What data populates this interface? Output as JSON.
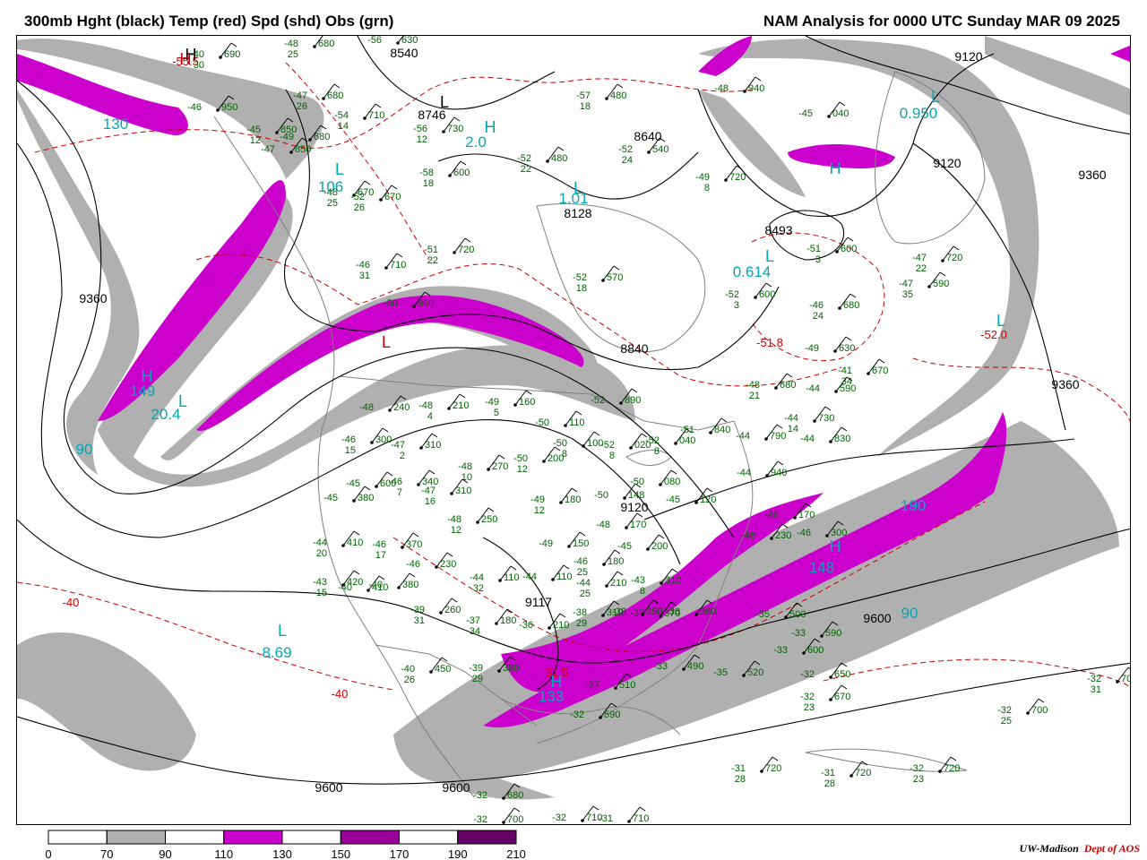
{
  "header": {
    "title_left": "300mb Hght (black) Temp (red) Spd (shd) Obs (grn)",
    "title_right": "NAM Analysis for 0000 UTC Sunday  MAR 09 2025"
  },
  "credit": {
    "org": "UW-Madison",
    "dept": "Dept of AOS"
  },
  "colors": {
    "height_contour": "#000000",
    "temp_contour": "#cc0000",
    "obs": "#006400",
    "speed_label": "#00a8b8",
    "border": "#808080",
    "speed_70_90": "#b0b0b0",
    "speed_110_130": "#cc00cc",
    "speed_150_170": "#990099",
    "speed_190_210": "#660066"
  },
  "legend": {
    "ticks": [
      "0",
      "70",
      "90",
      "110",
      "130",
      "150",
      "170",
      "190",
      "210"
    ],
    "bins": [
      {
        "from": "70",
        "to": "90",
        "color": "#b0b0b0"
      },
      {
        "from": "110",
        "to": "130",
        "color": "#cc00cc"
      },
      {
        "from": "150",
        "to": "170",
        "color": "#990099"
      },
      {
        "from": "190",
        "to": "210",
        "color": "#660066"
      }
    ]
  },
  "height_labels": [
    {
      "text": "8540"
    },
    {
      "text": "8746"
    },
    {
      "text": "8640"
    },
    {
      "text": "9120"
    },
    {
      "text": "9120"
    },
    {
      "text": "9360"
    },
    {
      "text": "9360"
    },
    {
      "text": "9360"
    },
    {
      "text": "8493"
    },
    {
      "text": "8840"
    },
    {
      "text": "8128"
    },
    {
      "text": "9120"
    },
    {
      "text": "9600"
    },
    {
      "text": "9600"
    },
    {
      "text": "9117"
    },
    {
      "text": "9600"
    }
  ],
  "temp_labels": [
    {
      "text": "-55.5"
    },
    {
      "text": "-51.8"
    },
    {
      "text": "-52.0"
    },
    {
      "text": "-40"
    },
    {
      "text": "-40"
    },
    {
      "text": "-31.5"
    }
  ],
  "pressure_centers": [
    {
      "letter": "H",
      "color": "#000000"
    },
    {
      "letter": "H",
      "color": "#cc0000"
    },
    {
      "letter": "L",
      "color": "#000000"
    },
    {
      "letter": "L",
      "color": "#cc0000"
    },
    {
      "letter": "H",
      "color": "#00a8b8"
    },
    {
      "letter": "L",
      "color": "#00a8b8"
    },
    {
      "letter": "L",
      "color": "#00a8b8"
    },
    {
      "letter": "L",
      "color": "#00a8b8"
    },
    {
      "letter": "L",
      "color": "#00a8b8"
    },
    {
      "letter": "L",
      "color": "#00a8b8"
    },
    {
      "letter": "H",
      "color": "#00a8b8"
    },
    {
      "letter": "L",
      "color": "#00a8b8"
    },
    {
      "letter": "H",
      "color": "#00a8b8"
    },
    {
      "letter": "L",
      "color": "#00a8b8"
    },
    {
      "letter": "H",
      "color": "#00a8b8"
    },
    {
      "letter": "H",
      "color": "#00a8b8"
    }
  ],
  "speed_labels": [
    {
      "text": "130"
    },
    {
      "text": "106"
    },
    {
      "text": "2.0"
    },
    {
      "text": "1.01"
    },
    {
      "text": "0.950"
    },
    {
      "text": "0.614"
    },
    {
      "text": "149"
    },
    {
      "text": "20.4"
    },
    {
      "text": "90"
    },
    {
      "text": "90"
    },
    {
      "text": "130"
    },
    {
      "text": "148"
    },
    {
      "text": "8.69"
    },
    {
      "text": "90"
    },
    {
      "text": "133"
    }
  ],
  "stations": [
    {
      "t": "-48",
      "d": "25",
      "v": "680"
    },
    {
      "t": "-40",
      "d": "30",
      "v": "690"
    },
    {
      "t": "-56",
      "d": "",
      "v": "630"
    },
    {
      "t": "-47",
      "d": "26",
      "v": "680"
    },
    {
      "t": "-54",
      "d": "14",
      "v": "710"
    },
    {
      "t": "-45",
      "d": "12",
      "v": "850"
    },
    {
      "t": "-49",
      "d": "",
      "v": "680"
    },
    {
      "t": "-47",
      "d": "",
      "v": "850"
    },
    {
      "t": "-46",
      "d": "",
      "v": "950"
    },
    {
      "t": "-56",
      "d": "12",
      "v": "730"
    },
    {
      "t": "-57",
      "d": "18",
      "v": "480"
    },
    {
      "t": "-52",
      "d": "22",
      "v": "480"
    },
    {
      "t": "-52",
      "d": "24",
      "v": "540"
    },
    {
      "t": "-48",
      "d": "",
      "v": "940"
    },
    {
      "t": "-45",
      "d": "",
      "v": "040"
    },
    {
      "t": "-48",
      "d": "25",
      "v": "670"
    },
    {
      "t": "-52",
      "d": "26",
      "v": "670"
    },
    {
      "t": "-58",
      "d": "18",
      "v": "600"
    },
    {
      "t": "-49",
      "d": "8",
      "v": "720"
    },
    {
      "t": "-51",
      "d": "22",
      "v": "720"
    },
    {
      "t": "-46",
      "d": "31",
      "v": "710"
    },
    {
      "t": "-52",
      "d": "18",
      "v": "570"
    },
    {
      "t": "-51",
      "d": "3",
      "v": "600"
    },
    {
      "t": "-47",
      "d": "22",
      "v": "720"
    },
    {
      "t": "-47",
      "d": "35",
      "v": "590"
    },
    {
      "t": "-52",
      "d": "3",
      "v": "600"
    },
    {
      "t": "-46",
      "d": "24",
      "v": "680"
    },
    {
      "t": "-50",
      "d": "",
      "v": "900"
    },
    {
      "t": "-49",
      "d": "",
      "v": "630"
    },
    {
      "t": "-41",
      "d": "34",
      "v": "670"
    },
    {
      "t": "-48",
      "d": "21",
      "v": "680"
    },
    {
      "t": "-44",
      "d": "",
      "v": "590"
    },
    {
      "t": "-48",
      "d": "",
      "v": "240"
    },
    {
      "t": "-48",
      "d": "4",
      "v": "210"
    },
    {
      "t": "-49",
      "d": "5",
      "v": "160"
    },
    {
      "t": "-52",
      "d": "",
      "v": "890"
    },
    {
      "t": "-46",
      "d": "15",
      "v": "300"
    },
    {
      "t": "-47",
      "d": "2",
      "v": "310"
    },
    {
      "t": "-50",
      "d": "",
      "v": "110"
    },
    {
      "t": "-50",
      "d": "8",
      "v": "100"
    },
    {
      "t": "-52",
      "d": "8",
      "v": "020"
    },
    {
      "t": "-52",
      "d": "8",
      "v": "040"
    },
    {
      "t": "-51",
      "d": "",
      "v": "840"
    },
    {
      "t": "-44",
      "d": "",
      "v": "790"
    },
    {
      "t": "-44",
      "d": "14",
      "v": "730"
    },
    {
      "t": "-44",
      "d": "",
      "v": "830"
    },
    {
      "t": "-48",
      "d": "10",
      "v": "270"
    },
    {
      "t": "-50",
      "d": "12",
      "v": "200"
    },
    {
      "t": "-46",
      "d": "7",
      "v": "340"
    },
    {
      "t": "-47",
      "d": "16",
      "v": "310"
    },
    {
      "t": "-45",
      "d": "",
      "v": "380"
    },
    {
      "t": "-45",
      "d": "",
      "v": "600"
    },
    {
      "t": "-49",
      "d": "12",
      "v": "180"
    },
    {
      "t": "-50",
      "d": "",
      "v": "148"
    },
    {
      "t": "-50",
      "d": "",
      "v": "080"
    },
    {
      "t": "-45",
      "d": "",
      "v": "120"
    },
    {
      "t": "-44",
      "d": "",
      "v": "940"
    },
    {
      "t": "-48",
      "d": "12",
      "v": "250"
    },
    {
      "t": "-48",
      "d": "",
      "v": "170"
    },
    {
      "t": "-46",
      "d": "",
      "v": "170"
    },
    {
      "t": "-44",
      "d": "20",
      "v": "410"
    },
    {
      "t": "-46",
      "d": "17",
      "v": "370"
    },
    {
      "t": "-49",
      "d": "",
      "v": "150"
    },
    {
      "t": "-45",
      "d": "",
      "v": "200"
    },
    {
      "t": "-46",
      "d": "",
      "v": "230"
    },
    {
      "t": "-46",
      "d": "",
      "v": "300"
    },
    {
      "t": "-46",
      "d": "25",
      "v": "180"
    },
    {
      "t": "-46",
      "d": "",
      "v": "230"
    },
    {
      "t": "-44",
      "d": "32",
      "v": "110"
    },
    {
      "t": "-44",
      "d": "",
      "v": "110"
    },
    {
      "t": "-44",
      "d": "25",
      "v": "210"
    },
    {
      "t": "-43",
      "d": "8",
      "v": "310"
    },
    {
      "t": "-43",
      "d": "15",
      "v": "420"
    },
    {
      "t": "-40",
      "d": "",
      "v": "410"
    },
    {
      "t": "-40",
      "d": "",
      "v": "380"
    },
    {
      "t": "-39",
      "d": "31",
      "v": "260"
    },
    {
      "t": "-37",
      "d": "34",
      "v": "180"
    },
    {
      "t": "-38",
      "d": "29",
      "v": "310"
    },
    {
      "t": "-38",
      "d": "",
      "v": "350"
    },
    {
      "t": "-37",
      "d": "",
      "v": "370"
    },
    {
      "t": "-38",
      "d": "",
      "v": "380"
    },
    {
      "t": "-36",
      "d": "",
      "v": "210"
    },
    {
      "t": "-33",
      "d": "",
      "v": "590"
    },
    {
      "t": "-35",
      "d": "",
      "v": "500"
    },
    {
      "t": "-33",
      "d": "",
      "v": "600"
    },
    {
      "t": "-40",
      "d": "26",
      "v": "450"
    },
    {
      "t": "-39",
      "d": "29",
      "v": "380"
    },
    {
      "t": "-37",
      "d": "",
      "v": "510"
    },
    {
      "t": "-33",
      "d": "",
      "v": "490"
    },
    {
      "t": "-35",
      "d": "",
      "v": "520"
    },
    {
      "t": "-32",
      "d": "",
      "v": "590"
    },
    {
      "t": "-32",
      "d": "",
      "v": "650"
    },
    {
      "t": "-32",
      "d": "23",
      "v": "670"
    },
    {
      "t": "-32",
      "d": "31",
      "v": "700"
    },
    {
      "t": "-32",
      "d": "25",
      "v": "700"
    },
    {
      "t": "-31",
      "d": "28",
      "v": "720"
    },
    {
      "t": "-31",
      "d": "28",
      "v": "720"
    },
    {
      "t": "-32",
      "d": "23",
      "v": "720"
    },
    {
      "t": "-32",
      "d": "",
      "v": "680"
    },
    {
      "t": "-32",
      "d": "",
      "v": "700"
    },
    {
      "t": "-32",
      "d": "",
      "v": "710"
    },
    {
      "t": "-31",
      "d": "",
      "v": "710"
    }
  ]
}
